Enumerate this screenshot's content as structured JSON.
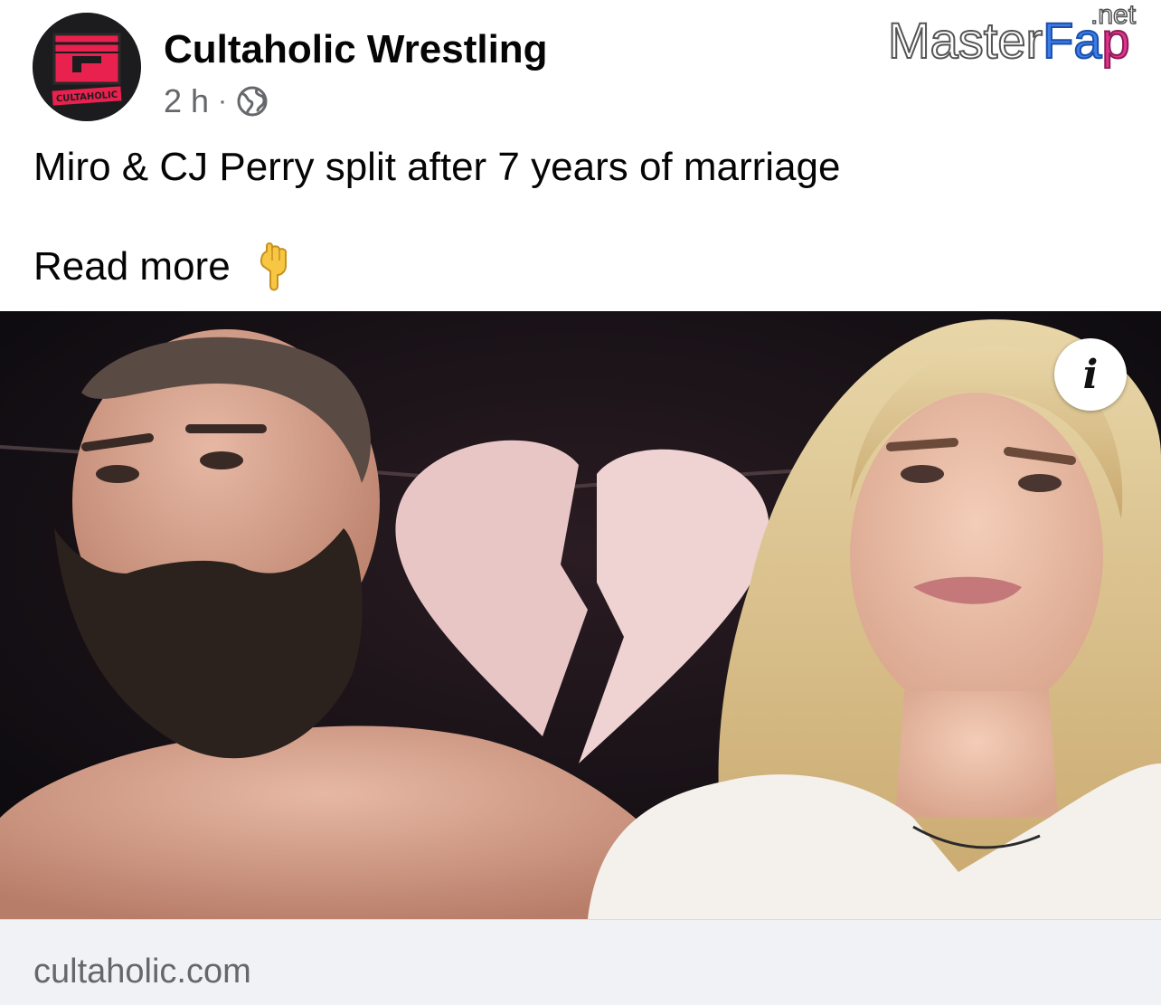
{
  "post": {
    "page_name": "Cultaholic Wrestling",
    "avatar_logo_text": "CULTAHOLIC",
    "time": "2 h",
    "separator": "·",
    "audience_icon": "globe-icon",
    "headline": "Miro & CJ Perry split after 7 years of marriage",
    "read_more": "Read more",
    "pointing_emoji": "👇"
  },
  "watermark": {
    "main": "MasterFap",
    "suffix": ".net"
  },
  "image": {
    "info_button_icon": "info-icon",
    "info_glyph": "i"
  },
  "link_preview": {
    "domain": "cultaholic.com"
  },
  "colors": {
    "page_name": "#050505",
    "meta_gray": "#65676b",
    "link_bar_bg": "#f0f2f5",
    "logo_red": "#e8214f",
    "watermark_blue": "#3b7de9",
    "watermark_pink": "#e0358f"
  }
}
